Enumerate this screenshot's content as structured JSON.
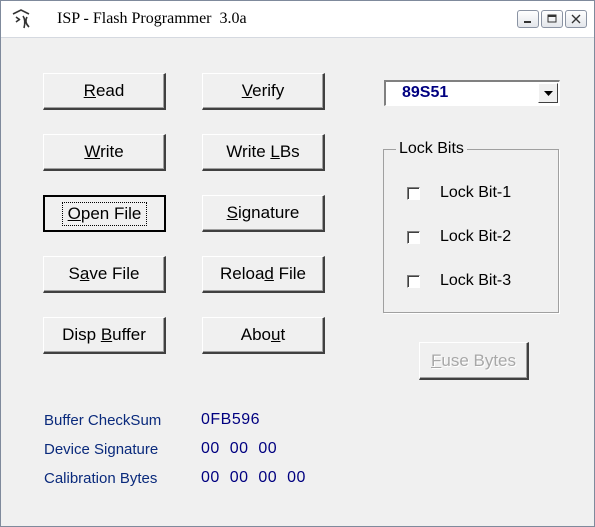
{
  "window": {
    "title": "ISP - Flash Programmer  3.0a",
    "app_icon": "chinese-character-icon"
  },
  "title_buttons": [
    {
      "name": "minimize",
      "icon": "minimize-icon"
    },
    {
      "name": "maximize",
      "icon": "maximize-icon"
    },
    {
      "name": "close",
      "icon": "close-icon"
    }
  ],
  "buttons": {
    "read": {
      "pre": "",
      "key": "R",
      "post": "ead"
    },
    "verify": {
      "pre": "",
      "key": "V",
      "post": "erify"
    },
    "write": {
      "pre": "",
      "key": "W",
      "post": "rite"
    },
    "write_lbs": {
      "pre": "Write ",
      "key": "L",
      "post": "Bs"
    },
    "open_file": {
      "pre": "",
      "key": "O",
      "post": "pen File"
    },
    "signature": {
      "pre": "",
      "key": "S",
      "post": "ignature"
    },
    "save_file": {
      "pre": "S",
      "key": "a",
      "post": "ve File"
    },
    "reload_file": {
      "pre": "Reloa",
      "key": "d",
      "post": " File"
    },
    "disp_buffer": {
      "pre": "Disp ",
      "key": "B",
      "post": "uffer"
    },
    "about": {
      "pre": "Abo",
      "key": "u",
      "post": "t"
    },
    "fuse_bytes": {
      "pre": "",
      "key": "F",
      "post": "use Bytes"
    }
  },
  "device_select": {
    "value": "89S51"
  },
  "lock_bits": {
    "label": "Lock Bits",
    "items": [
      {
        "label": "Lock Bit-1",
        "checked": false
      },
      {
        "label": "Lock Bit-2",
        "checked": false
      },
      {
        "label": "Lock Bit-3",
        "checked": false
      }
    ]
  },
  "info": {
    "buffer_checksum": {
      "label": "Buffer CheckSum",
      "value": "0FB596"
    },
    "device_signature": {
      "label": "Device Signature",
      "value": "00  00  00"
    },
    "calibration_bytes": {
      "label": "Calibration Bytes",
      "value": "00  00  00  00"
    }
  },
  "colors": {
    "info_text": "#0a2a7c",
    "value_text": "#000080",
    "disabled_text": "#a8a8a8",
    "face": "#f0f0f0"
  }
}
